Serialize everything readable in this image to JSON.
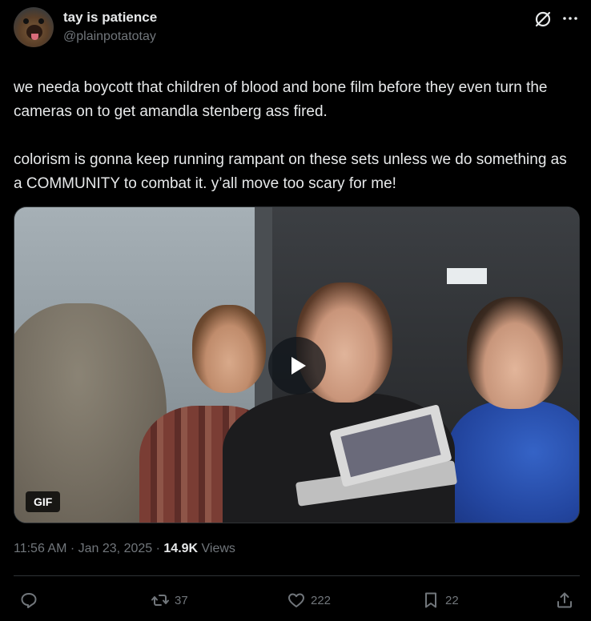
{
  "author": {
    "display_name": "tay is patience",
    "handle": "@plainpotatotay"
  },
  "post": {
    "paragraph1": "we needa boycott that children of blood and bone film before they even turn the cameras on to get amandla stenberg ass fired.",
    "paragraph2": "colorism is gonna keep running rampant on these sets unless we do something as a COMMUNITY to combat it. y’all move too scary for me!"
  },
  "media": {
    "badge": "GIF",
    "overlay_icon": "play-icon"
  },
  "meta": {
    "time": "11:56 AM",
    "sep1": " · ",
    "date": "Jan 23, 2025",
    "sep2": " · ",
    "views_count": "14.9K",
    "views_label": " Views"
  },
  "actions": {
    "reply_count": "",
    "retweet_count": "37",
    "like_count": "222",
    "bookmark_count": "22"
  },
  "icons": {
    "header": [
      "grok-icon",
      "more-icon"
    ],
    "actions": [
      "reply-icon",
      "retweet-icon",
      "like-icon",
      "bookmark-icon",
      "share-icon"
    ]
  },
  "colors": {
    "background": "#000000",
    "primary_text": "#e7e9ea",
    "secondary_text": "#71767b",
    "divider": "#2f3336"
  }
}
